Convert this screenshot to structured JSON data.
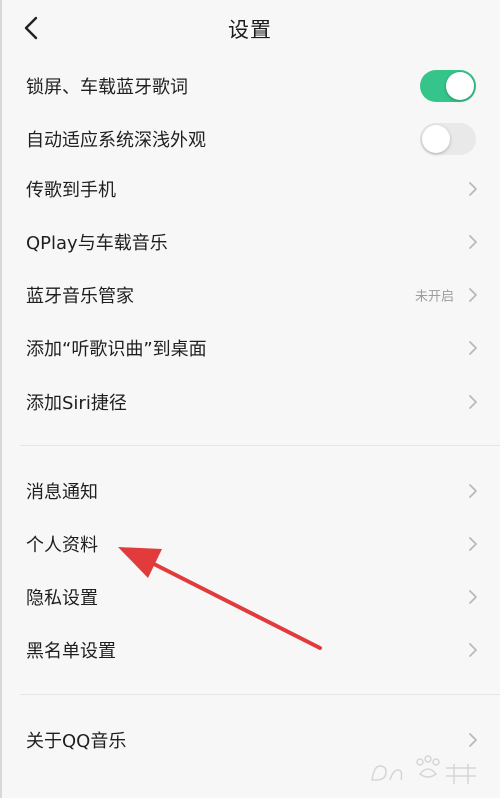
{
  "header": {
    "title": "设置",
    "back_icon": "chevron-left-icon"
  },
  "settings": {
    "group1": [
      {
        "label": "锁屏、车载蓝牙歌词",
        "control": "toggle",
        "toggle_on": true
      },
      {
        "label": "自动适应系统深浅外观",
        "control": "toggle",
        "toggle_on": false
      },
      {
        "label": "传歌到手机",
        "control": "chevron"
      },
      {
        "label": "QPlay与车载音乐",
        "control": "chevron"
      },
      {
        "label": "蓝牙音乐管家",
        "control": "chevron",
        "value": "未开启"
      },
      {
        "label": "添加“听歌识曲”到桌面",
        "control": "chevron"
      },
      {
        "label": "添加Siri捷径",
        "control": "chevron"
      }
    ],
    "group2": [
      {
        "label": "消息通知",
        "control": "chevron"
      },
      {
        "label": "个人资料",
        "control": "chevron"
      },
      {
        "label": "隐私设置",
        "control": "chevron"
      },
      {
        "label": "黑名单设置",
        "control": "chevron"
      }
    ],
    "group3": [
      {
        "label": "关于QQ音乐",
        "control": "chevron"
      }
    ]
  },
  "colors": {
    "toggle_on": "#35c48a",
    "toggle_off": "#e9e9e9",
    "annotation_arrow": "#e23b3b",
    "chevron": "#b9b9b9"
  },
  "annotation": {
    "icon": "red-arrow-icon",
    "points_to": "个人资料"
  },
  "watermark": {
    "icon": "baidu-watermark-logo"
  }
}
